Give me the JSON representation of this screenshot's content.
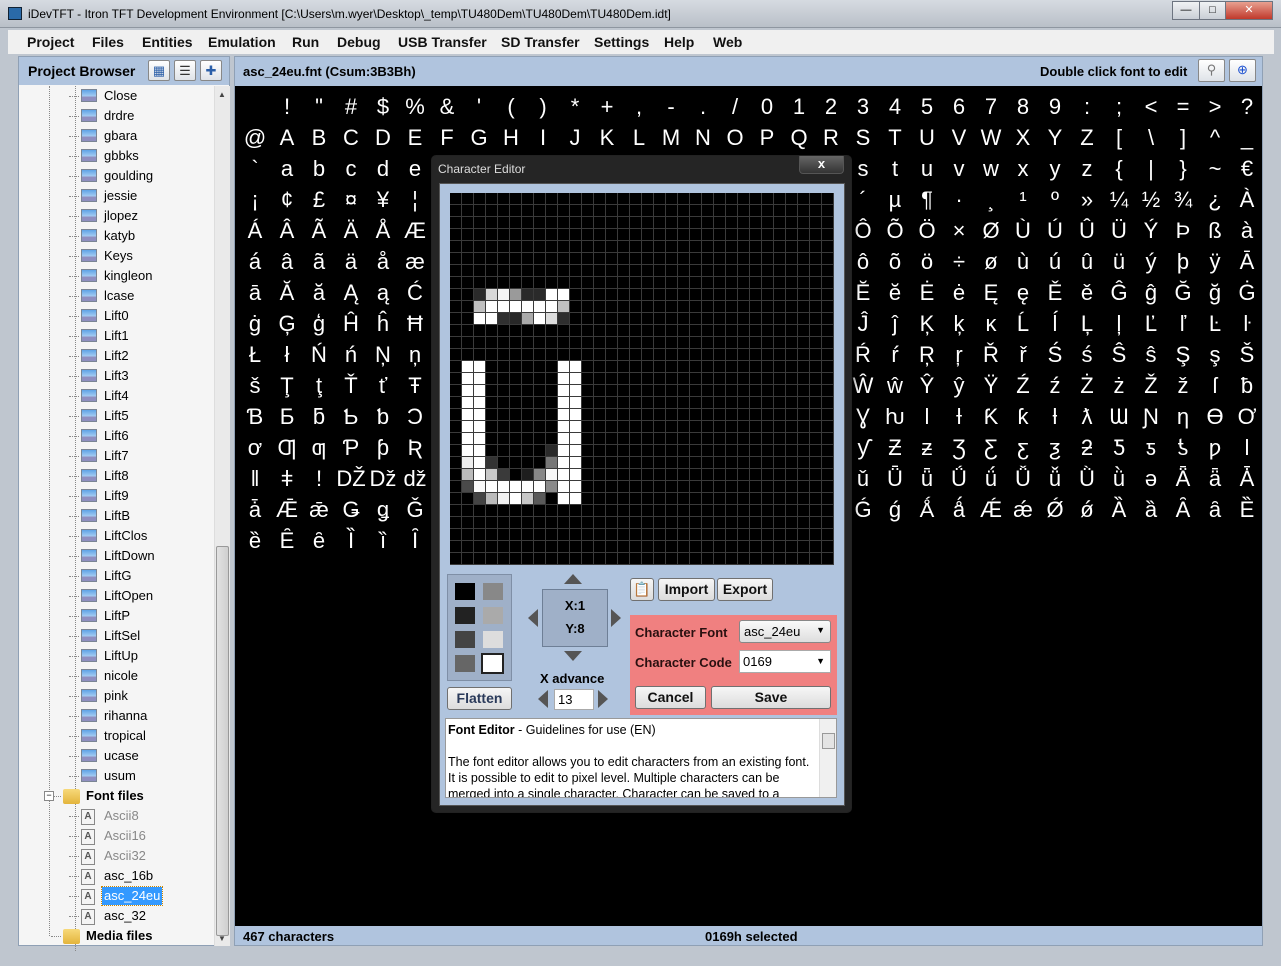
{
  "window": {
    "title": "iDevTFT - Itron TFT Development Environment  [C:\\Users\\m.wyer\\Desktop\\_temp\\TU480Dem\\TU480Dem\\TU480Dem.idt]",
    "minimize": "—",
    "maximize": "□",
    "close": "✕"
  },
  "menu": [
    "Project",
    "Files",
    "Entities",
    "Emulation",
    "Run",
    "Debug",
    "USB Transfer",
    "SD Transfer",
    "Settings",
    "Help",
    "Web"
  ],
  "project_browser": {
    "title": "Project Browser",
    "image_items": [
      "Close",
      "drdre",
      "gbara",
      "gbbks",
      "goulding",
      "jessie",
      "jlopez",
      "katyb",
      "Keys",
      "kingleon",
      "lcase",
      "Lift0",
      "Lift1",
      "Lift2",
      "Lift3",
      "Lift4",
      "Lift5",
      "Lift6",
      "Lift7",
      "Lift8",
      "Lift9",
      "LiftB",
      "LiftClos",
      "LiftDown",
      "LiftG",
      "LiftOpen",
      "LiftP",
      "LiftSel",
      "LiftUp",
      "nicole",
      "pink",
      "rihanna",
      "tropical",
      "ucase",
      "usum"
    ],
    "font_folder": "Font files",
    "font_items": [
      {
        "label": "Ascii8",
        "dimmed": true
      },
      {
        "label": "Ascii16",
        "dimmed": true
      },
      {
        "label": "Ascii32",
        "dimmed": true
      },
      {
        "label": "asc_16b",
        "dimmed": false
      },
      {
        "label": "asc_24eu",
        "selected": true
      },
      {
        "label": "asc_32",
        "dimmed": false
      }
    ],
    "media_folder": "Media files"
  },
  "font_view": {
    "title": "asc_24eu.fnt  (Csum:3B3Bh)",
    "hint": "Double click font to edit",
    "rows": [
      [
        " ",
        "!",
        "\"",
        "#",
        "$",
        "%",
        "&",
        "'",
        "(",
        ")",
        "*",
        "+",
        ",",
        "-",
        ".",
        "/",
        "0",
        "1",
        "2",
        "3",
        "4",
        "5",
        "6",
        "7",
        "8",
        "9",
        ":",
        ";",
        "<",
        "=",
        ">",
        "?"
      ],
      [
        "@",
        "A",
        "B",
        "C",
        "D",
        "E",
        "F",
        "G",
        "H",
        "I",
        "J",
        "K",
        "L",
        "M",
        "N",
        "O",
        "P",
        "Q",
        "R",
        "S",
        "T",
        "U",
        "V",
        "W",
        "X",
        "Y",
        "Z",
        "[",
        "\\",
        "]",
        "^",
        "_"
      ],
      [
        "`",
        "a",
        "b",
        "c",
        "d",
        "e",
        "",
        "",
        "",
        "",
        "",
        "",
        "",
        "",
        "",
        "",
        "",
        "",
        "",
        "s",
        "t",
        "u",
        "v",
        "w",
        "x",
        "y",
        "z",
        "{",
        "|",
        "}",
        "~",
        "€"
      ],
      [
        "¡",
        "¢",
        "£",
        "¤",
        "¥",
        "¦",
        "",
        "",
        "",
        "",
        "",
        "",
        "",
        "",
        "",
        "",
        "",
        "",
        "",
        "´",
        "µ",
        "¶",
        "·",
        "¸",
        "¹",
        "º",
        "»",
        "¼",
        "½",
        "¾",
        "¿",
        "À"
      ],
      [
        "Á",
        "Â",
        "Ã",
        "Ä",
        "Å",
        "Æ",
        "",
        "",
        "",
        "",
        "",
        "",
        "",
        "",
        "",
        "",
        "",
        "",
        "",
        "Ô",
        "Õ",
        "Ö",
        "×",
        "Ø",
        "Ù",
        "Ú",
        "Û",
        "Ü",
        "Ý",
        "Þ",
        "ß",
        "à"
      ],
      [
        "á",
        "â",
        "ã",
        "ä",
        "å",
        "æ",
        "",
        "",
        "",
        "",
        "",
        "",
        "",
        "",
        "",
        "",
        "",
        "",
        "",
        "ô",
        "õ",
        "ö",
        "÷",
        "ø",
        "ù",
        "ú",
        "û",
        "ü",
        "ý",
        "þ",
        "ÿ",
        "Ā"
      ],
      [
        "ā",
        "Ă",
        "ă",
        "Ą",
        "ą",
        "Ć",
        "",
        "",
        "",
        "",
        "",
        "",
        "",
        "",
        "",
        "",
        "",
        "",
        "",
        "Ĕ",
        "ĕ",
        "Ė",
        "ė",
        "Ę",
        "ę",
        "Ě",
        "ě",
        "Ĝ",
        "ĝ",
        "Ğ",
        "ğ",
        "Ġ"
      ],
      [
        "ġ",
        "Ģ",
        "ģ",
        "Ĥ",
        "ĥ",
        "Ħ",
        "",
        "",
        "",
        "",
        "",
        "",
        "",
        "",
        "",
        "",
        "",
        "",
        "",
        "Ĵ",
        "ĵ",
        "Ķ",
        "ķ",
        "ĸ",
        "Ĺ",
        "ĺ",
        "Ļ",
        "ļ",
        "Ľ",
        "ľ",
        "Ŀ",
        "ŀ"
      ],
      [
        "Ł",
        "ł",
        "Ń",
        "ń",
        "Ņ",
        "ņ",
        "",
        "",
        "",
        "",
        "",
        "",
        "",
        "",
        "",
        "",
        "",
        "",
        "",
        "Ŕ",
        "ŕ",
        "Ŗ",
        "ŗ",
        "Ř",
        "ř",
        "Ś",
        "ś",
        "Ŝ",
        "ŝ",
        "Ş",
        "ş",
        "Š"
      ],
      [
        "š",
        "Ţ",
        "ţ",
        "Ť",
        "ť",
        "Ŧ",
        "",
        "",
        "",
        "",
        "",
        "",
        "",
        "",
        "",
        "",
        "",
        "",
        "",
        "Ŵ",
        "ŵ",
        "Ŷ",
        "ŷ",
        "Ÿ",
        "Ź",
        "ź",
        "Ż",
        "ż",
        "Ž",
        "ž",
        "ſ",
        "ƀ"
      ],
      [
        "Ɓ",
        "Ƃ",
        "ƃ",
        "Ƅ",
        "ƅ",
        "Ɔ",
        "",
        "",
        "",
        "",
        "",
        "",
        "",
        "",
        "",
        "",
        "",
        "",
        "",
        "Ɣ",
        "ƕ",
        "Ɩ",
        "Ɨ",
        "Ƙ",
        "ƙ",
        "ƚ",
        "ƛ",
        "Ɯ",
        "Ɲ",
        "ƞ",
        "Ɵ",
        "Ơ"
      ],
      [
        "ơ",
        "Ƣ",
        "ƣ",
        "Ƥ",
        "ƥ",
        "Ʀ",
        "",
        "",
        "",
        "",
        "",
        "",
        "",
        "",
        "",
        "",
        "",
        "",
        "",
        "ƴ",
        "Ƶ",
        "ƶ",
        "Ʒ",
        "Ƹ",
        "ƹ",
        "ƺ",
        "ƻ",
        "Ƽ",
        "ƽ",
        "ƾ",
        "ƿ",
        "ǀ"
      ],
      [
        "ǁ",
        "ǂ",
        "ǃ",
        "Ǆ",
        "ǅ",
        "ǆ",
        "",
        "",
        "",
        "",
        "",
        "",
        "",
        "",
        "",
        "",
        "",
        "",
        "",
        "ǔ",
        "Ǖ",
        "ǖ",
        "Ǘ",
        "ǘ",
        "Ǚ",
        "ǚ",
        "Ǜ",
        "ǜ",
        "ǝ",
        "Ǟ",
        "ǟ",
        "Ǡ"
      ],
      [
        "ǡ",
        "Ǣ",
        "ǣ",
        "Ǥ",
        "ǥ",
        "Ǧ",
        "",
        "",
        "",
        "",
        "",
        "",
        "",
        "",
        "",
        "",
        "",
        "",
        "",
        "Ǵ",
        "ǵ",
        "Ǻ",
        "ǻ",
        "Ǽ",
        "ǽ",
        "Ǿ",
        "ǿ",
        "Ȁ",
        "ȁ",
        "Ȃ",
        "ȃ",
        "Ȅ"
      ],
      [
        "ȅ",
        "Ȇ",
        "ȇ",
        "Ȉ",
        "ȉ",
        "Ȋ"
      ]
    ],
    "status_count": "467 characters",
    "status_selected": "0169h selected"
  },
  "editor": {
    "title": "Character Editor",
    "close": "x",
    "glyph_pixels": [
      [
        8,
        2,
        "#2a2a2a"
      ],
      [
        8,
        3,
        "#d8d8d8"
      ],
      [
        8,
        4,
        "#f5f5f5"
      ],
      [
        8,
        5,
        "#9a9a9a"
      ],
      [
        8,
        6,
        "#2a2a2a"
      ],
      [
        8,
        7,
        "#2a2a2a"
      ],
      [
        8,
        8,
        "#ffffff"
      ],
      [
        8,
        9,
        "#ffffff"
      ],
      [
        9,
        2,
        "#c0c0c0"
      ],
      [
        9,
        3,
        "#ffffff"
      ],
      [
        9,
        4,
        "#ffffff"
      ],
      [
        9,
        5,
        "#ffffff"
      ],
      [
        9,
        6,
        "#ffffff"
      ],
      [
        9,
        7,
        "#ffffff"
      ],
      [
        9,
        8,
        "#ffffff"
      ],
      [
        9,
        9,
        "#c0c0c0"
      ],
      [
        10,
        2,
        "#ffffff"
      ],
      [
        10,
        3,
        "#ffffff"
      ],
      [
        10,
        4,
        "#303030"
      ],
      [
        10,
        5,
        "#282828"
      ],
      [
        10,
        6,
        "#aaaaaa"
      ],
      [
        10,
        7,
        "#ffffff"
      ],
      [
        10,
        8,
        "#dddddd"
      ],
      [
        10,
        9,
        "#2e2e2e"
      ],
      [
        14,
        1,
        "#ffffff"
      ],
      [
        14,
        2,
        "#ffffff"
      ],
      [
        14,
        9,
        "#ffffff"
      ],
      [
        14,
        10,
        "#ffffff"
      ],
      [
        15,
        1,
        "#ffffff"
      ],
      [
        15,
        2,
        "#ffffff"
      ],
      [
        15,
        9,
        "#ffffff"
      ],
      [
        15,
        10,
        "#ffffff"
      ],
      [
        16,
        1,
        "#ffffff"
      ],
      [
        16,
        2,
        "#ffffff"
      ],
      [
        16,
        9,
        "#ffffff"
      ],
      [
        16,
        10,
        "#ffffff"
      ],
      [
        17,
        1,
        "#ffffff"
      ],
      [
        17,
        2,
        "#ffffff"
      ],
      [
        17,
        9,
        "#ffffff"
      ],
      [
        17,
        10,
        "#ffffff"
      ],
      [
        18,
        1,
        "#ffffff"
      ],
      [
        18,
        2,
        "#ffffff"
      ],
      [
        18,
        9,
        "#ffffff"
      ],
      [
        18,
        10,
        "#ffffff"
      ],
      [
        19,
        1,
        "#ffffff"
      ],
      [
        19,
        2,
        "#ffffff"
      ],
      [
        19,
        9,
        "#ffffff"
      ],
      [
        19,
        10,
        "#ffffff"
      ],
      [
        20,
        1,
        "#ffffff"
      ],
      [
        20,
        2,
        "#ffffff"
      ],
      [
        20,
        9,
        "#ffffff"
      ],
      [
        20,
        10,
        "#ffffff"
      ],
      [
        21,
        1,
        "#ffffff"
      ],
      [
        21,
        2,
        "#ffffff"
      ],
      [
        21,
        8,
        "#2a2a2a"
      ],
      [
        21,
        9,
        "#ffffff"
      ],
      [
        21,
        10,
        "#ffffff"
      ],
      [
        22,
        1,
        "#eeeeee"
      ],
      [
        22,
        2,
        "#ffffff"
      ],
      [
        22,
        3,
        "#333333"
      ],
      [
        22,
        8,
        "#777777"
      ],
      [
        22,
        9,
        "#ffffff"
      ],
      [
        22,
        10,
        "#ffffff"
      ],
      [
        23,
        1,
        "#bbbbbb"
      ],
      [
        23,
        2,
        "#ffffff"
      ],
      [
        23,
        3,
        "#c8c8c8"
      ],
      [
        23,
        4,
        "#3a3a3a"
      ],
      [
        23,
        6,
        "#1e1e1e"
      ],
      [
        23,
        7,
        "#888888"
      ],
      [
        23,
        8,
        "#f8f8f8"
      ],
      [
        23,
        9,
        "#ffffff"
      ],
      [
        23,
        10,
        "#ffffff"
      ],
      [
        24,
        1,
        "#4a4a4a"
      ],
      [
        24,
        2,
        "#fafafa"
      ],
      [
        24,
        3,
        "#ffffff"
      ],
      [
        24,
        4,
        "#ffffff"
      ],
      [
        24,
        5,
        "#ffffff"
      ],
      [
        24,
        6,
        "#ffffff"
      ],
      [
        24,
        7,
        "#ffffff"
      ],
      [
        24,
        8,
        "#8a8a8a"
      ],
      [
        24,
        9,
        "#ffffff"
      ],
      [
        24,
        10,
        "#ffffff"
      ],
      [
        25,
        2,
        "#444444"
      ],
      [
        25,
        3,
        "#bbbbbb"
      ],
      [
        25,
        4,
        "#f2f2f2"
      ],
      [
        25,
        5,
        "#ffffff"
      ],
      [
        25,
        6,
        "#c8c8c8"
      ],
      [
        25,
        7,
        "#5a5a5a"
      ],
      [
        25,
        9,
        "#ffffff"
      ],
      [
        25,
        10,
        "#ffffff"
      ]
    ],
    "palette": [
      "#000000",
      "#888888",
      "#222222",
      "#aaaaaa",
      "#444444",
      "#dddddd",
      "#666666",
      "#ffffff"
    ],
    "palette_selected": 7,
    "flatten": "Flatten",
    "x_pos": "X:1",
    "y_pos": "Y:8",
    "x_advance_label": "X advance",
    "x_advance": "13",
    "import": "Import",
    "export": "Export",
    "char_font_label": "Character Font",
    "char_font": "asc_24eu",
    "char_code_label": "Character Code",
    "char_code": "0169",
    "cancel": "Cancel",
    "save": "Save",
    "help_title": "Font Editor",
    "help_subtitle": " - Guidelines for use (EN)",
    "help_text": "The font editor allows you to edit characters from an existing font. It is possible to edit to pixel level. Multiple characters can be merged into a single character. Character can be saved to a"
  },
  "colors": {
    "panel": "#b0c4de",
    "code_panel": "#f08080",
    "selection": "#3399ff"
  }
}
